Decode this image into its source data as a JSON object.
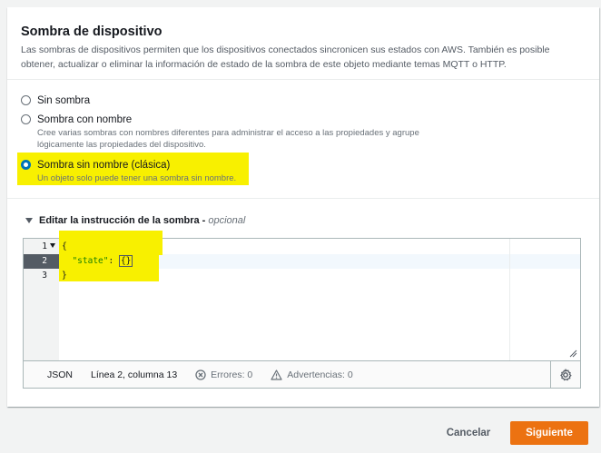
{
  "panel": {
    "title": "Sombra de dispositivo",
    "description": "Las sombras de dispositivos permiten que los dispositivos conectados sincronicen sus estados con AWS. También es posible obtener, actualizar o eliminar la información de estado de la sombra de este objeto mediante temas MQTT o HTTP."
  },
  "options": [
    {
      "label": "Sin sombra",
      "description": "",
      "selected": false
    },
    {
      "label": "Sombra con nombre",
      "description": "Cree varias sombras con nombres diferentes para administrar el acceso a las propiedades y agrupe lógicamente las propiedades del dispositivo.",
      "selected": false
    },
    {
      "label": "Sombra sin nombre (clásica)",
      "description": "Un objeto solo puede tener una sombra sin nombre.",
      "selected": true
    }
  ],
  "expander": {
    "label": "Editar la instrucción de la sombra",
    "dash": "-",
    "optional": "opcional"
  },
  "editor": {
    "line_numbers": [
      "1",
      "2",
      "3"
    ],
    "lines": {
      "l1": "{",
      "l2_indent": "  ",
      "l2_key": "\"state\"",
      "l2_colon": ": ",
      "l2_value": "{}",
      "l3": "}"
    },
    "status": {
      "mode": "JSON",
      "position": "Línea 2, columna 13",
      "errors": "Errores: 0",
      "warnings": "Advertencias: 0"
    }
  },
  "actions": {
    "cancel": "Cancelar",
    "next": "Siguiente"
  },
  "colors": {
    "primary": "#ec7211",
    "selected_radio": "#0073bb",
    "highlight": "#f8f000",
    "json_key": "#1d8102"
  }
}
